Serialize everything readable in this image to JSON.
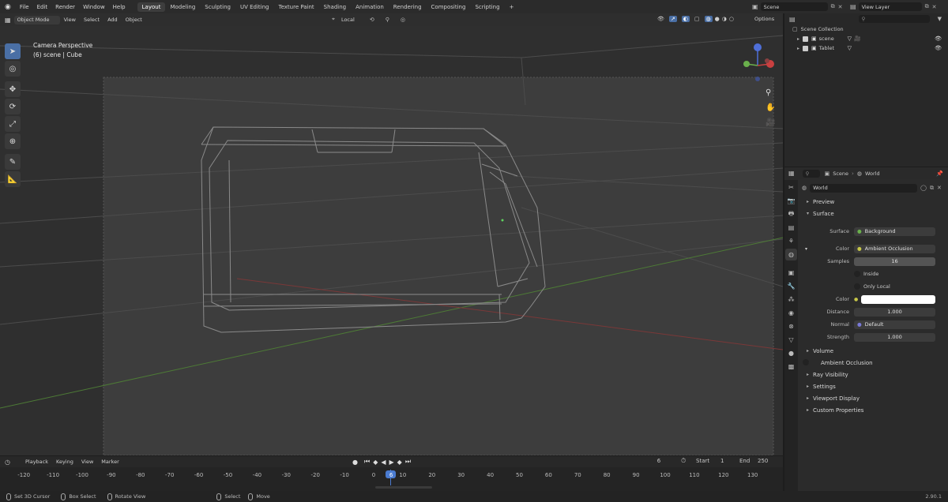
{
  "topbar": {
    "menus": [
      "File",
      "Edit",
      "Render",
      "Window",
      "Help"
    ],
    "workspaces": [
      "Layout",
      "Modeling",
      "Sculpting",
      "UV Editing",
      "Texture Paint",
      "Shading",
      "Animation",
      "Rendering",
      "Compositing",
      "Scripting"
    ],
    "active_workspace": "Layout",
    "add_tab": "+",
    "scene_name": "Scene",
    "view_layer": "View Layer"
  },
  "vp_header": {
    "mode": "Object Mode",
    "menus": [
      "View",
      "Select",
      "Add",
      "Object"
    ],
    "transform_orientation": "Local",
    "options": "Options"
  },
  "viewport": {
    "camera_label": "Camera Perspective",
    "object_label": "(6) scene | Cube"
  },
  "outliner": {
    "collection": "Scene Collection",
    "items": [
      {
        "label": "scene"
      },
      {
        "label": "Tablet"
      }
    ]
  },
  "properties": {
    "breadcrumb_scene": "Scene",
    "breadcrumb_world": "World",
    "world_name": "World",
    "panels": {
      "preview": "Preview",
      "surface": "Surface",
      "volume": "Volume",
      "ambient_occlusion": "Ambient Occlusion",
      "ray_visibility": "Ray Visibility",
      "settings": "Settings",
      "viewport_display": "Viewport Display",
      "custom_properties": "Custom Properties"
    },
    "surface_label": "Surface",
    "surface_value": "Background",
    "color_label": "Color",
    "color_value": "Ambient Occlusion",
    "samples_label": "Samples",
    "samples_value": "16",
    "inside_label": "Inside",
    "only_local_label": "Only Local",
    "color2_label": "Color",
    "color2_value": "#ffffff",
    "distance_label": "Distance",
    "distance_value": "1.000",
    "normal_label": "Normal",
    "normal_value": "Default",
    "strength_label": "Strength",
    "strength_value": "1.000"
  },
  "timeline": {
    "menus": [
      "Playback",
      "Keying",
      "View",
      "Marker"
    ],
    "current_frame": "6",
    "start_label": "Start",
    "start_value": "1",
    "end_label": "End",
    "end_value": "250",
    "ticks": [
      "-120",
      "-110",
      "-100",
      "-90",
      "-80",
      "-70",
      "-60",
      "-50",
      "-40",
      "-30",
      "-20",
      "-10",
      "0",
      "6",
      "10",
      "20",
      "30",
      "40",
      "50",
      "60",
      "70",
      "80",
      "90",
      "100",
      "110",
      "120",
      "130"
    ]
  },
  "statusbar": {
    "items": [
      "Set 3D Cursor",
      "Box Select",
      "Rotate View",
      "Select",
      "Move"
    ],
    "version": "2.90.1"
  },
  "colors": {
    "accent": "#4a6fa5",
    "x_axis": "#c94040",
    "y_axis": "#6ab04c",
    "z_axis": "#4f6fd8"
  }
}
